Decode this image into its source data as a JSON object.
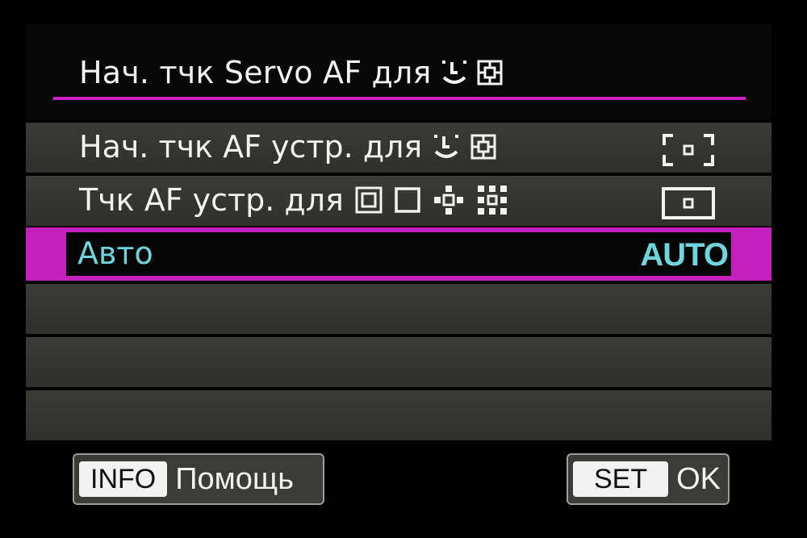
{
  "header": {
    "title": "Нач. тчк Servo AF для",
    "title_icons": [
      "face-tracking-icon",
      "af-area-icon"
    ]
  },
  "menu": {
    "items": [
      {
        "label": "Нач. тчк AF устр. для",
        "icons": [
          "face-tracking-icon",
          "af-area-icon"
        ],
        "value_icon": "af-frame-bracket-icon",
        "selected": false
      },
      {
        "label": "Тчк AF устр. для",
        "icons": [
          "zone-af-icon",
          "single-point-icon",
          "expanded-point-icon",
          "expanded-around-icon"
        ],
        "value_icon": "af-frame-box-icon",
        "selected": false
      },
      {
        "label": "Авто",
        "value": "AUTO",
        "selected": true
      }
    ]
  },
  "footer": {
    "info_key": "INFO",
    "info_label": "Помощь",
    "set_key": "SET",
    "set_label": "OK"
  },
  "colors": {
    "accent": "#c51fbe",
    "selected_text": "#6dd6dc",
    "row_bg": "#35352f",
    "text": "#f2f2f2"
  }
}
